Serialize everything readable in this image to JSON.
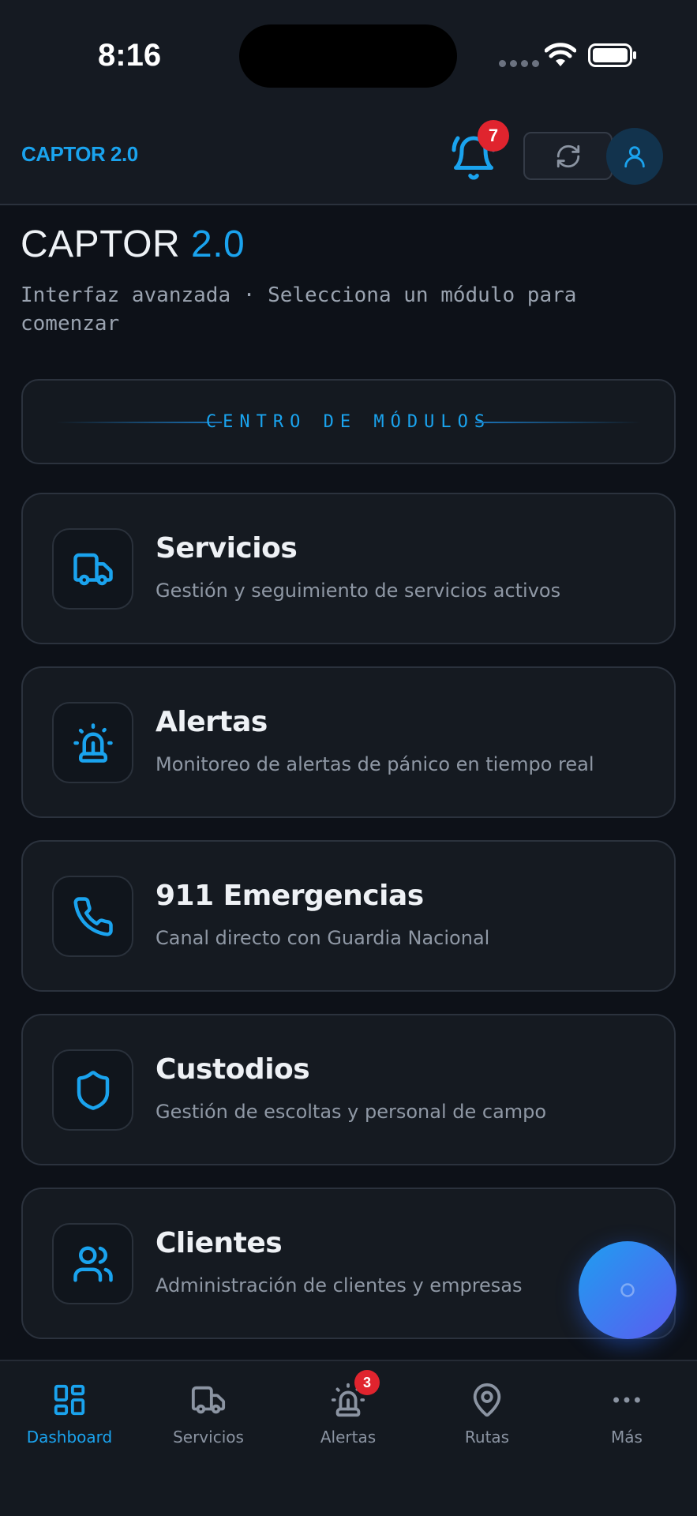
{
  "status_bar": {
    "time": "8:16"
  },
  "header": {
    "brand": "CAPTOR 2.0",
    "notification_count": "7"
  },
  "page": {
    "title_main": "CAPTOR",
    "title_accent": "2.0",
    "subtitle": "Interfaz avanzada · Selecciona un módulo para comenzar"
  },
  "module_center": {
    "label": "CENTRO DE MÓDULOS"
  },
  "modules": [
    {
      "title": "Servicios",
      "description": "Gestión y seguimiento de servicios activos",
      "icon": "truck-icon"
    },
    {
      "title": "Alertas",
      "description": "Monitoreo de alertas de pánico en tiempo real",
      "icon": "siren-icon"
    },
    {
      "title": "911 Emergencias",
      "description": "Canal directo con Guardia Nacional",
      "icon": "phone-icon"
    },
    {
      "title": "Custodios",
      "description": "Gestión de escoltas y personal de campo",
      "icon": "shield-icon"
    },
    {
      "title": "Clientes",
      "description": "Administración de clientes y empresas",
      "icon": "users-icon"
    }
  ],
  "bottom_nav": {
    "items": [
      {
        "label": "Dashboard",
        "icon": "dashboard-icon",
        "active": true
      },
      {
        "label": "Servicios",
        "icon": "truck-icon",
        "active": false
      },
      {
        "label": "Alertas",
        "icon": "siren-icon",
        "active": false
      },
      {
        "label": "Rutas",
        "icon": "map-pin-icon",
        "active": false
      },
      {
        "label": "Más",
        "icon": "more-icon",
        "active": false
      }
    ],
    "alerts_badge": "3"
  },
  "colors": {
    "accent": "#1aa3ee",
    "badge": "#e0242e",
    "background": "#0d1118"
  }
}
